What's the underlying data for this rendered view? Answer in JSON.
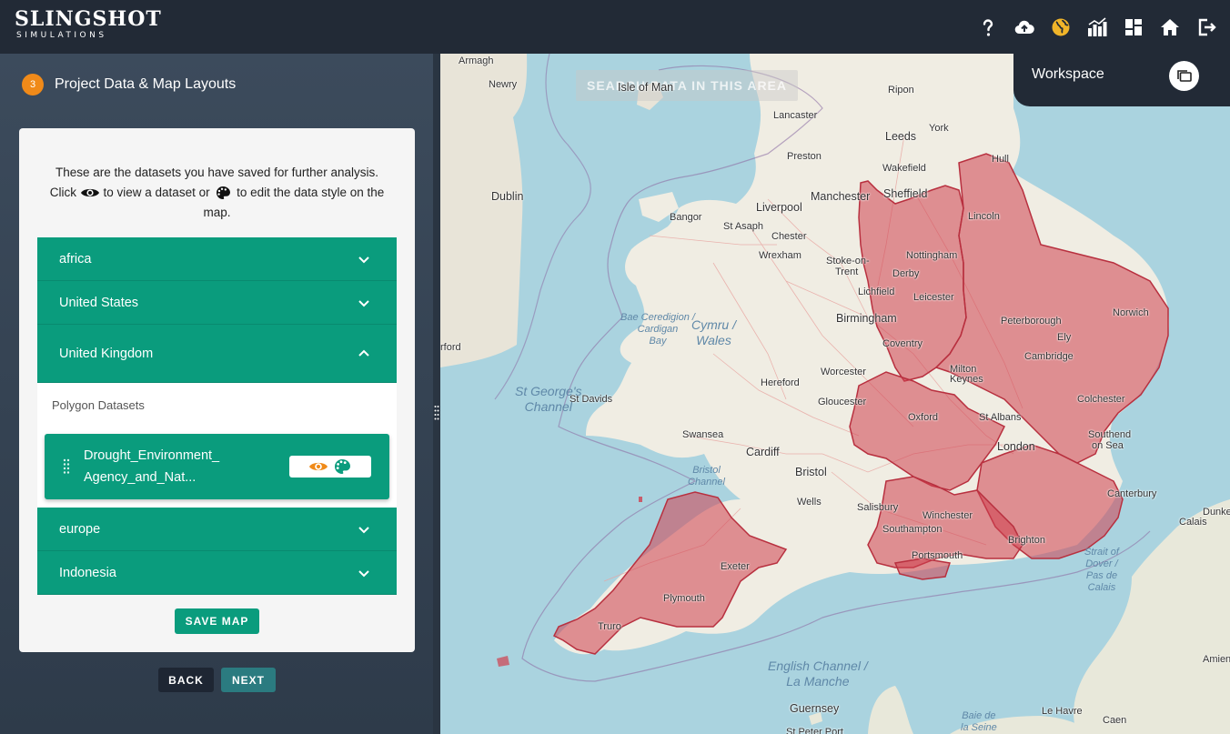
{
  "app": {
    "logo_main": "SLINGSHOT",
    "logo_sub": "SIMULATIONS"
  },
  "toolbar": {
    "icons": [
      "help-icon",
      "cloud-upload-icon",
      "globe-icon",
      "analytics-icon",
      "dashboard-icon",
      "home-icon",
      "logout-icon"
    ],
    "accent_color": "#f0b429"
  },
  "step": {
    "number": "3",
    "title": "Project Data & Map Layouts"
  },
  "intro": {
    "part1": "These are the datasets you have saved for further analysis. Click",
    "part2": "to view a dataset or",
    "part3": "to edit the data style on the map."
  },
  "groups": [
    {
      "label": "africa"
    },
    {
      "label": "United States"
    },
    {
      "label": "United Kingdom"
    },
    {
      "label": "europe"
    },
    {
      "label": "Indonesia"
    }
  ],
  "open_group": {
    "sub_label": "Polygon Datasets",
    "dataset_name": "Drought_Environment_ Agency_and_Nat..."
  },
  "buttons": {
    "save": "SAVE MAP",
    "back": "BACK",
    "next": "NEXT"
  },
  "map": {
    "search_area": "SEARCH DATA IN THIS AREA",
    "workspace_label": "Workspace",
    "polygon_color": "#d0404e",
    "labels": {
      "armagh": "Armagh",
      "newry": "Newry",
      "isle_of_man": "Isle of Man",
      "ripon": "Ripon",
      "lancaster": "Lancaster",
      "york": "York",
      "leeds": "Leeds",
      "preston": "Preston",
      "hull": "Hull",
      "wakefield": "Wakefield",
      "dublin": "Dublin",
      "manchester": "Manchester",
      "sheffield": "Sheffield",
      "lincoln": "Lincoln",
      "bangor": "Bangor",
      "st_asaph": "St Asaph",
      "liverpool": "Liverpool",
      "chester": "Chester",
      "wrexham": "Wrexham",
      "stoke": "Stoke-on-",
      "trent": "Trent",
      "nottingham": "Nottingham",
      "derby": "Derby",
      "lichfield": "Lichfield",
      "leicester": "Leicester",
      "norwich": "Norwich",
      "peterborough": "Peterborough",
      "birmingham": "Birmingham",
      "ely": "Ely",
      "coventry": "Coventry",
      "cambridge": "Cambridge",
      "worcester": "Worcester",
      "milton": "Milton",
      "keynes": "Keynes",
      "hereford": "Hereford",
      "colchester": "Colchester",
      "st_davids": "St Davids",
      "gloucester": "Gloucester",
      "oxford": "Oxford",
      "st_albans": "St Albans",
      "swansea": "Swansea",
      "london": "London",
      "southend": "Southend",
      "on_sea": "on Sea",
      "cardiff": "Cardiff",
      "bristol": "Bristol",
      "canterbury": "Canterbury",
      "wells": "Wells",
      "salisbury": "Salisbury",
      "winchester": "Winchester",
      "calais": "Calais",
      "dunke": "Dunke",
      "southampton": "Southampton",
      "brighton": "Brighton",
      "portsmouth": "Portsmouth",
      "exeter": "Exeter",
      "plymouth": "Plymouth",
      "truro": "Truro",
      "amien": "Amien",
      "guernsey": "Guernsey",
      "le_havre": "Le Havre",
      "st_peter_port": "St Peter Port",
      "caen": "Caen",
      "rford": "rford"
    },
    "sea_labels": {
      "bae_ceredigion": [
        "Bae Ceredigion /",
        "Cardigan",
        "Bay"
      ],
      "cymru": [
        "Cymru /",
        "Wales"
      ],
      "st_georges": [
        "St George's",
        "Channel"
      ],
      "bristol_channel": [
        "Bristol",
        "Channel"
      ],
      "strait_dover": [
        "Strait of",
        "Dover /",
        "Pas de",
        "Calais"
      ],
      "english_channel": [
        "English Channel /",
        "La Manche"
      ],
      "baie_seine": [
        "Baie de",
        "la Seine"
      ]
    }
  }
}
